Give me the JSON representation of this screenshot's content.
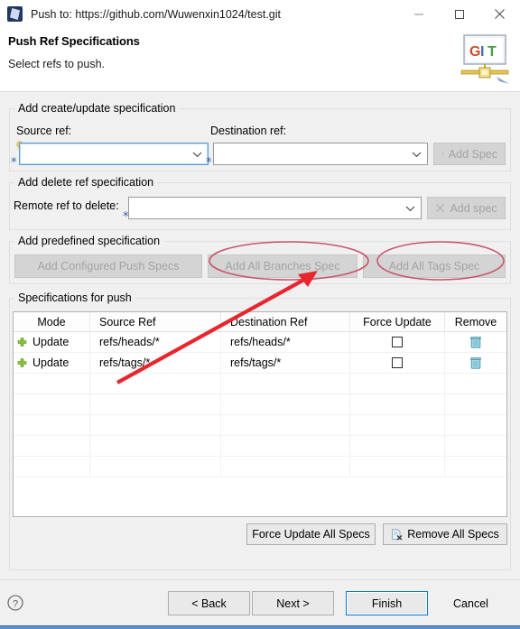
{
  "window": {
    "title": "Push to: https://github.com/Wuwenxin1024/test.git",
    "app_icon": "eclipse-icon",
    "minimize_label": "—",
    "maximize_label": "maximize-icon",
    "close_label": "✕"
  },
  "wizard": {
    "heading": "Push Ref Specifications",
    "description": "Select refs to push.",
    "banner_icon": "git-logo-icon",
    "banner_text": "GIT"
  },
  "create_update_group": {
    "legend": "Add create/update specification",
    "source_label": "Source ref:",
    "source_value": "",
    "source_placeholder": "",
    "source_focused": true,
    "destination_label": "Destination ref:",
    "destination_value": "",
    "destination_placeholder": "",
    "add_spec_label": "Add Spec",
    "add_spec_disabled": true,
    "add_spec_icon": "add-spec-icon",
    "required_marker": "*",
    "hint_icon": "lightbulb-icon"
  },
  "delete_group": {
    "legend": "Add delete ref specification",
    "remote_label": "Remote ref to delete:",
    "remote_value": "",
    "remote_placeholder": "",
    "add_spec_label": "Add spec",
    "add_spec_disabled": true,
    "add_spec_icon": "delete-spec-icon",
    "required_marker": "*"
  },
  "predefined_group": {
    "legend": "Add predefined specification",
    "buttons": [
      {
        "label": "Add Configured Push Specs",
        "disabled": true
      },
      {
        "label": "Add All Branches Spec",
        "disabled": true
      },
      {
        "label": "Add All Tags Spec",
        "disabled": true
      }
    ]
  },
  "specifications_group": {
    "legend": "Specifications for push",
    "columns": [
      "Mode",
      "Source Ref",
      "Destination Ref",
      "Force Update",
      "Remove"
    ],
    "rows": [
      {
        "mode_icon": "plus-icon",
        "mode": "Update",
        "source_ref": "refs/heads/*",
        "destination_ref": "refs/heads/*",
        "force_update": false,
        "remove_icon": "trash-icon"
      },
      {
        "mode_icon": "plus-icon",
        "mode": "Update",
        "source_ref": "refs/tags/*",
        "destination_ref": "refs/tags/*",
        "force_update": false,
        "remove_icon": "trash-icon"
      }
    ],
    "empty_row_count": 5,
    "force_update_all_label": "Force Update All Specs",
    "remove_all_label": "Remove All Specs",
    "remove_all_icon": "remove-all-specs-icon"
  },
  "footer": {
    "help_icon": "help-icon",
    "back_label": "< Back",
    "next_label": "Next >",
    "finish_label": "Finish",
    "cancel_label": "Cancel",
    "default_button": "Finish"
  },
  "annotations": {
    "color": "#c8566a",
    "arrow_color": "#e8262f",
    "ellipse_1_target": "Add All Branches Spec",
    "ellipse_2_target": "Add All Tags Spec",
    "arrow_points_to": "Add All Branches Spec"
  },
  "colors": {
    "accent_blue": "#5b8fc9",
    "default_button_border": "#0078d7",
    "plus_green": "#7fbf4d",
    "trash_teal": "#4aa3b8",
    "annotation_red": "#c8566a",
    "window_bg": "#f0f0f0"
  }
}
